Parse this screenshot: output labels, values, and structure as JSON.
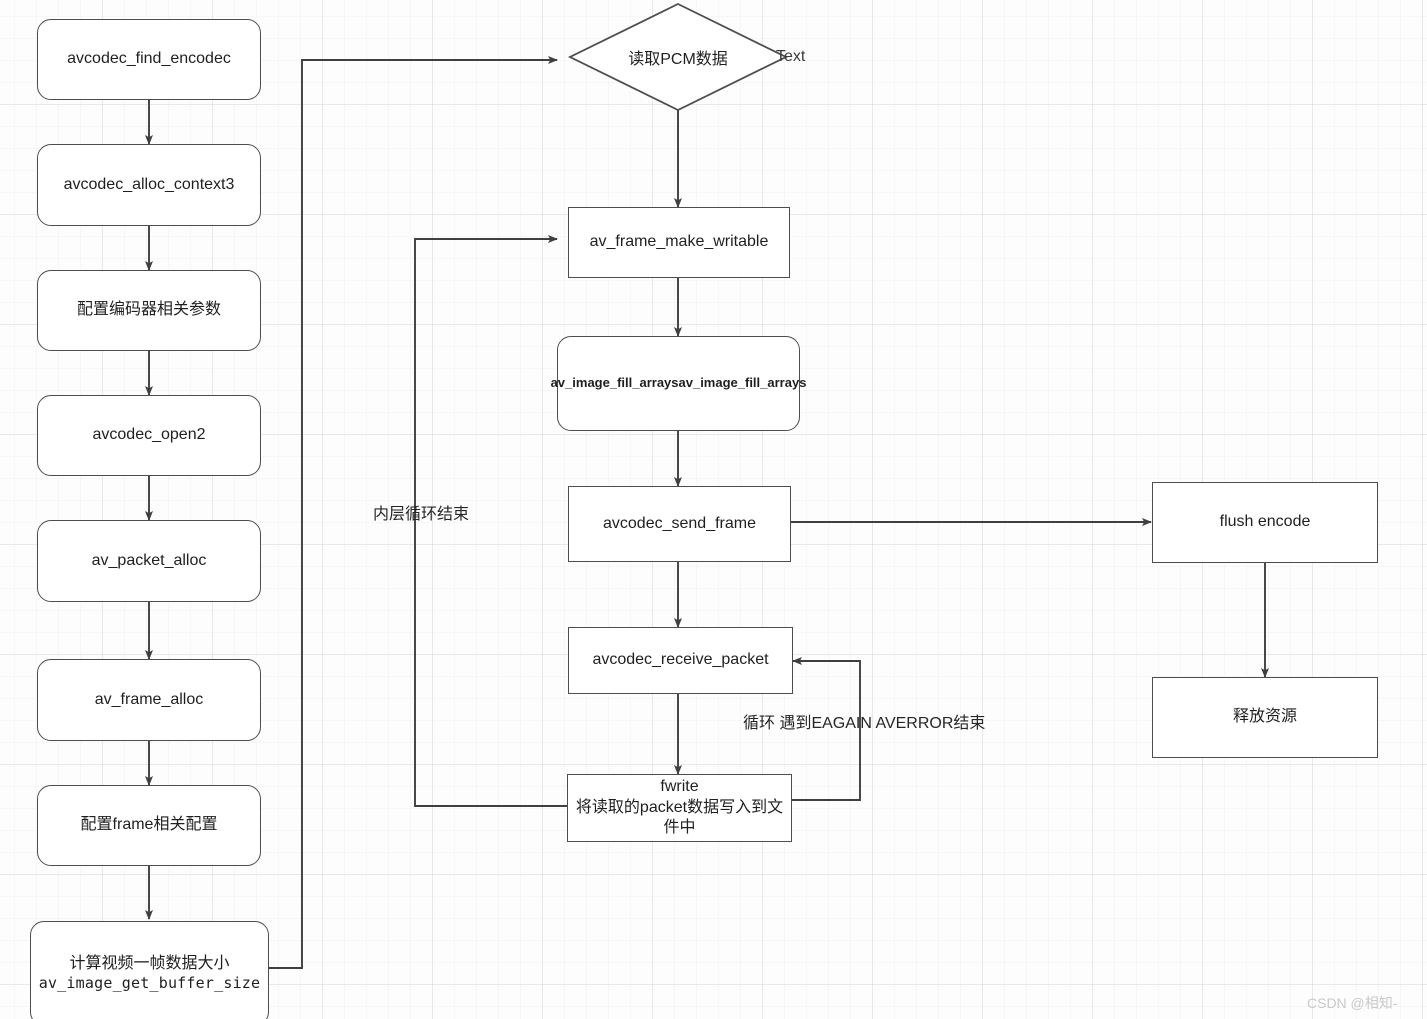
{
  "diagram": {
    "title_watermark": "CSDN @相知-",
    "colors": {
      "stroke": "#4d4d4d",
      "wire": "#3f3f3f",
      "text": "#1f1f1f",
      "grid_major": "#e8e8e8",
      "grid_minor": "#f5f5f5",
      "node_fill": "#ffffff",
      "watermark": "#c9c9c9"
    },
    "left_column": [
      {
        "id": "avcodec_find_encodec",
        "label": "avcodec_find_encodec"
      },
      {
        "id": "avcodec_alloc_context3",
        "label": "avcodec_alloc_context3"
      },
      {
        "id": "config_encoder_params",
        "label": "配置编码器相关参数"
      },
      {
        "id": "avcodec_open2",
        "label": "avcodec_open2"
      },
      {
        "id": "av_packet_alloc",
        "label": "av_packet_alloc"
      },
      {
        "id": "av_frame_alloc",
        "label": "av_frame_alloc"
      },
      {
        "id": "config_frame",
        "label": "配置frame相关配置"
      }
    ],
    "left_last_node": {
      "id": "av_image_get_buffer_size",
      "line1": "计算视频一帧数据大小",
      "line2": "av_image_get_buffer_size"
    },
    "decision": {
      "id": "read_pcm_data",
      "label": "读取PCM数据",
      "side_text": "Text"
    },
    "middle_column": [
      {
        "id": "av_frame_make_writable",
        "label": "av_frame_make_writable"
      },
      {
        "id": "av_image_fill_arrays",
        "label": "av_image_fill_arraysav_image_fill_arrays"
      },
      {
        "id": "avcodec_send_frame",
        "label": "avcodec_send_frame"
      },
      {
        "id": "avcodec_receive_packet",
        "label": "avcodec_receive_packet"
      }
    ],
    "fwrite_node": {
      "id": "fwrite",
      "line1": "fwrite",
      "line2": "将读取的packet数据写入到文",
      "line3": "件中"
    },
    "right_column": [
      {
        "id": "flush_encode",
        "label": "flush encode"
      },
      {
        "id": "release_resource",
        "label": "释放资源"
      }
    ],
    "edge_labels": {
      "inner_loop_end": "内层循环结束",
      "eagain_loop": "循环 遇到EAGAIN  AVERROR结束"
    }
  }
}
